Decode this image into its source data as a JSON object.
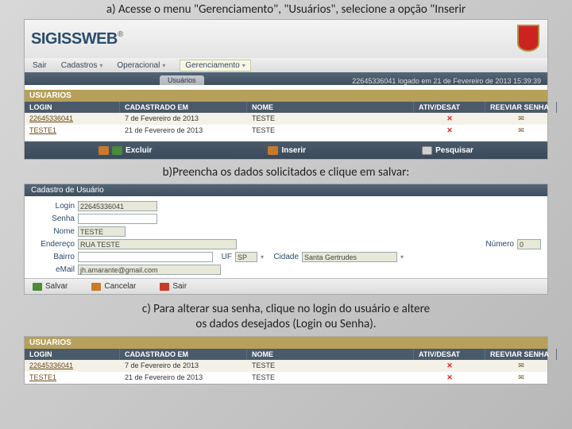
{
  "captions": {
    "a": "a) Acesse o menu \"Gerenciamento\", \"Usuários\", selecione a opção \"Inserir",
    "b": "b)Preencha os dados solicitados e clique em salvar:",
    "c_line1": "c) Para alterar sua senha, clique no login do usuário e altere",
    "c_line2": "os dados desejados (Login ou Senha)."
  },
  "app": {
    "logo_text": "SIGISSWEB",
    "logo_mark": "®",
    "menu": {
      "sair": "Sair",
      "cadastros": "Cadastros",
      "operacional": "Operacional",
      "gerenciamento": "Gerenciamento"
    },
    "tab_label": "Usuários",
    "status_right": "22645336041 logado em 21 de Fevereiro de 2013 15:39:39"
  },
  "tableA": {
    "title": "USUARIOS",
    "cols": {
      "login": "LOGIN",
      "cad": "CADASTRADO EM",
      "nome": "NOME",
      "ativ": "ATIV/DESAT",
      "reenv": "REEVIAR SENHA"
    },
    "rows": [
      {
        "login": "22645336041",
        "cad": "7 de Fevereiro de 2013",
        "nome": "TESTE",
        "x": "✕",
        "mail": "✉"
      },
      {
        "login": "TESTE1",
        "cad": "21 de Fevereiro de 2013",
        "nome": "TESTE",
        "x": "✕",
        "mail": "✉"
      }
    ]
  },
  "buttons": {
    "excluir": "Excluir",
    "inserir": "Inserir",
    "pesquisar": "Pesquisar"
  },
  "formB": {
    "title": "Cadastro de Usuário",
    "labels": {
      "login": "Login",
      "senha": "Senha",
      "nome": "Nome",
      "endereco": "Endereço",
      "bairro": "Bairro",
      "uf": "UF",
      "cidade": "Cidade",
      "email": "eMail",
      "numero": "Número"
    },
    "values": {
      "login": "22645336041",
      "senha": "",
      "nome": "TESTE",
      "endereco": "RUA TESTE",
      "bairro": "",
      "uf": "SP",
      "cidade": "Santa Gertrudes",
      "numero": "0",
      "email": "jh.amarante@gmail.com"
    },
    "actions": {
      "salvar": "Salvar",
      "cancelar": "Cancelar",
      "sair": "Sair"
    }
  },
  "tableC": {
    "title": "USUARIOS",
    "cols": {
      "login": "LOGIN",
      "cad": "CADASTRADO EM",
      "nome": "NOME",
      "ativ": "ATIV/DESAT",
      "reenv": "REEVIAR SENHA"
    },
    "rows": [
      {
        "login": "22645336041",
        "cad": "7 de Fevereiro de 2013",
        "nome": "TESTE",
        "x": "✕",
        "mail": "✉"
      },
      {
        "login": "TESTE1",
        "cad": "21 de Fevereiro de 2013",
        "nome": "TESTE",
        "x": "✕",
        "mail": "✉"
      }
    ]
  }
}
